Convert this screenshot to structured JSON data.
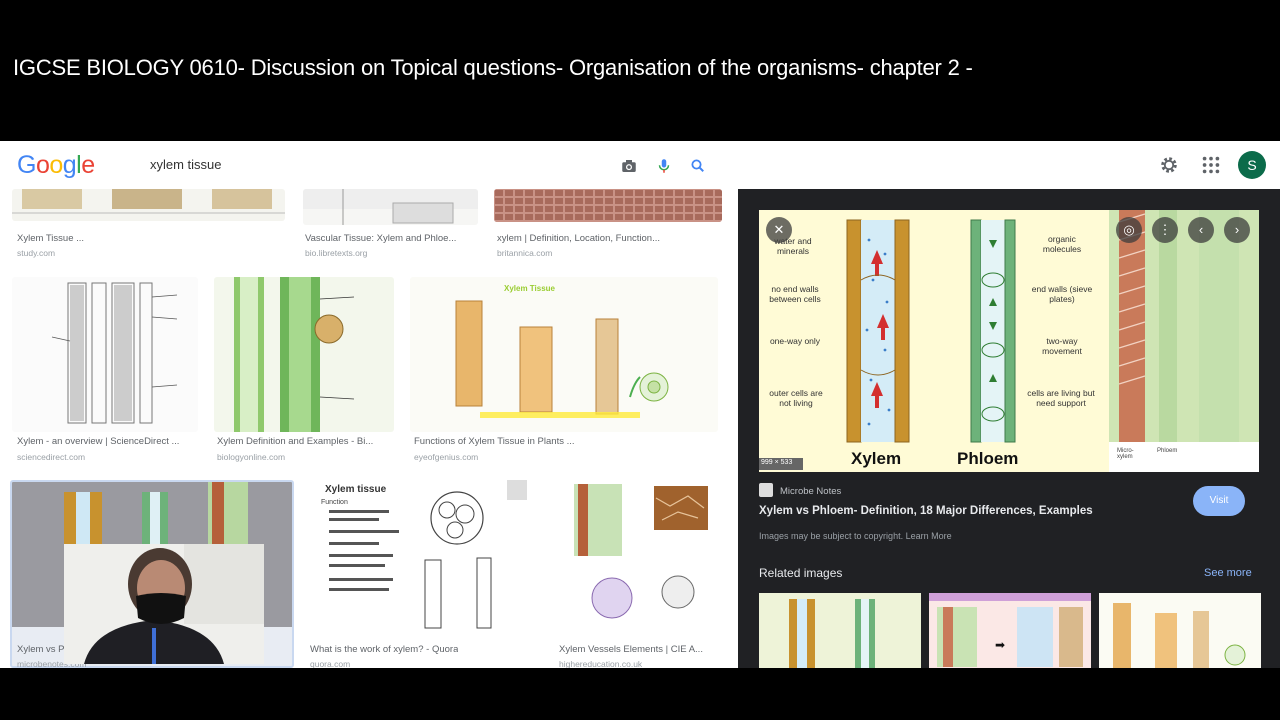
{
  "video": {
    "title": "IGCSE BIOLOGY 0610- Discussion on Topical questions- Organisation of the organisms- chapter 2 -"
  },
  "header": {
    "logo": [
      "G",
      "o",
      "o",
      "g",
      "l",
      "e"
    ],
    "search_value": "xylem tissue",
    "avatar_letter": "S",
    "icons": [
      "camera-icon",
      "microphone-icon",
      "search-icon",
      "settings-gear-icon",
      "apps-grid-icon"
    ]
  },
  "results": {
    "row1": [
      {
        "title": "Xylem Tissue ...",
        "site": "study.com"
      },
      {
        "title": "Vascular Tissue: Xylem and Phloe...",
        "site": "bio.libretexts.org"
      },
      {
        "title": "xylem | Definition, Location, Function...",
        "site": "britannica.com"
      }
    ],
    "row2": [
      {
        "title": "Xylem - an overview | ScienceDirect ...",
        "site": "sciencedirect.com"
      },
      {
        "title": "Xylem Definition and Examples - Bi...",
        "site": "biologyonline.com"
      },
      {
        "title": "Functions of Xylem Tissue in Plants ...",
        "site": "eyeofgenius.com"
      }
    ],
    "row3": [
      {
        "title": "Xylem vs Phloem...",
        "site": "microbenotes.com"
      },
      {
        "title": "What is the work of xylem? - Quora",
        "site": "quora.com",
        "image_heading": "Xylem tissue",
        "image_sub": "Function"
      },
      {
        "title": "Xylem Vessels Elements | CIE A...",
        "site": "highereducation.co.uk"
      }
    ],
    "row2_mid_image_label": "Xylem Tissue"
  },
  "panel": {
    "preview": {
      "left_labels": [
        "water and minerals",
        "no end walls between cells",
        "one-way only",
        "outer cells are not living"
      ],
      "right_labels": [
        "organic molecules",
        "end walls (sieve plates)",
        "two-way movement",
        "cells are living but need support"
      ],
      "xylem_label": "Xylem",
      "phloem_label": "Phloem",
      "size_badge": "999 × 533",
      "bottom_small_labels": [
        "Micro-xylem",
        "Phloem"
      ]
    },
    "source": "Microbe Notes",
    "title": "Xylem vs Phloem- Definition, 18 Major Differences, Examples",
    "copyright": "Images may be subject to copyright. Learn More",
    "visit": "Visit",
    "related_heading": "Related images",
    "see_more": "See more"
  },
  "colors": {
    "xylem_wall": "#c8922e",
    "phloem_wall": "#6db27a",
    "flow_arrow": "#d32f2f",
    "panel_bg": "#202124",
    "link_blue": "#8ab4f8"
  }
}
